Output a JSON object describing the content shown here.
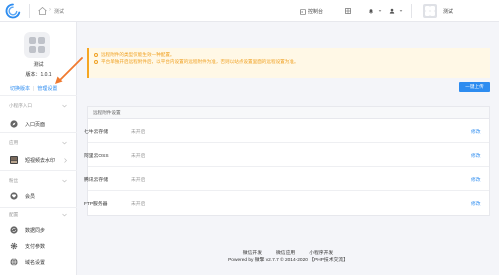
{
  "header": {
    "breadcrumb": "测试",
    "nav": [
      "控制台",
      "",
      "",
      ""
    ],
    "user_name": "测试"
  },
  "sidebar": {
    "app_name": "测试",
    "version": "版本：1.0.1",
    "link_switch": "切换版本",
    "link_manage": "管理设置",
    "sections": {
      "miniapp": "小程序入口",
      "apps": "应用",
      "member": "粉丝",
      "config": "配置"
    },
    "items": {
      "entry_page": "入口页面",
      "watermark": "短视频去水印",
      "member": "会员",
      "data_sync": "数据同步",
      "payment": "支付参数",
      "domain": "域名设置"
    }
  },
  "notice": {
    "line1": "远程附件的类型仅能生效一种配置。",
    "line2": "平台单独开启远程附件后，以平台内设置的远程附件为准，否则以站点设置里面的远程设置为准。"
  },
  "add_button": "一键上传",
  "panel": {
    "title": "远程附件设置",
    "rows": [
      {
        "name": "七牛云存储",
        "status": "未开启",
        "action": "修改"
      },
      {
        "name": "阿里云OSS",
        "status": "未开启",
        "action": "修改"
      },
      {
        "name": "腾讯云存储",
        "status": "未开启",
        "action": "修改"
      },
      {
        "name": "FTP服务器",
        "status": "未开启",
        "action": "修改"
      }
    ]
  },
  "footer": {
    "links": [
      "微信开发",
      "微信应用",
      "小程序开发"
    ],
    "copyright": "Powered by 微擎 v2.7.7 © 2014-2020 【PHP技术交流】"
  },
  "colors": {
    "accent": "#2d8cf0",
    "warning": "#f0a020",
    "arrow": "#f07a30"
  }
}
